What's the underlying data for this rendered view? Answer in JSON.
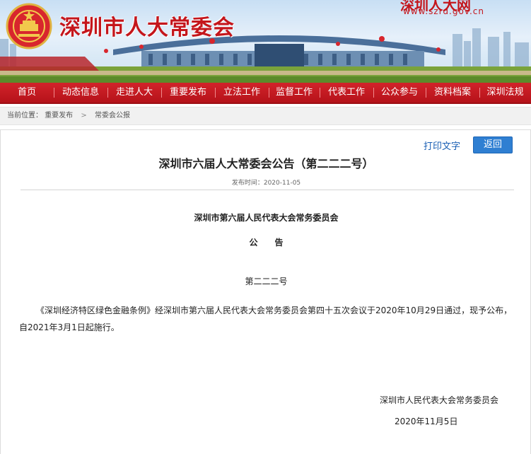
{
  "banner": {
    "title": "深圳市人大常委会",
    "site_name": "深圳人大网",
    "url": "www.szrd.gov.cn"
  },
  "nav": {
    "items": [
      {
        "label": "首页"
      },
      {
        "label": "动态信息"
      },
      {
        "label": "走进人大"
      },
      {
        "label": "重要发布"
      },
      {
        "label": "立法工作"
      },
      {
        "label": "监督工作"
      },
      {
        "label": "代表工作"
      },
      {
        "label": "公众参与"
      },
      {
        "label": "资料档案"
      },
      {
        "label": "深圳法规"
      }
    ]
  },
  "breadcrumb": {
    "prefix": "当前位置：",
    "items": [
      "重要发布",
      "常委会公报"
    ],
    "separator": ">"
  },
  "toolbar": {
    "print_label": "打印文字",
    "back_label": "返回"
  },
  "article": {
    "title": "深圳市六届人大常委会公告（第二二二号）",
    "publish_date": "发布时间：2020-11-05",
    "issuer": "深圳市第六届人民代表大会常务委员会",
    "notice_heading": "公　　告",
    "number": "第二二二号",
    "body": "《深圳经济特区绿色金融条例》经深圳市第六届人民代表大会常务委员会第四十五次会议于2020年10月29日通过，现予公布，自2021年3月1日起施行。",
    "signature": "深圳市人民代表大会常务委员会",
    "sign_date": "2020年11月5日"
  },
  "colors": {
    "brand_red": "#c4161c",
    "nav_red": "#c51b22",
    "link_blue": "#1a5fb4",
    "button_blue": "#2f7fd2"
  }
}
